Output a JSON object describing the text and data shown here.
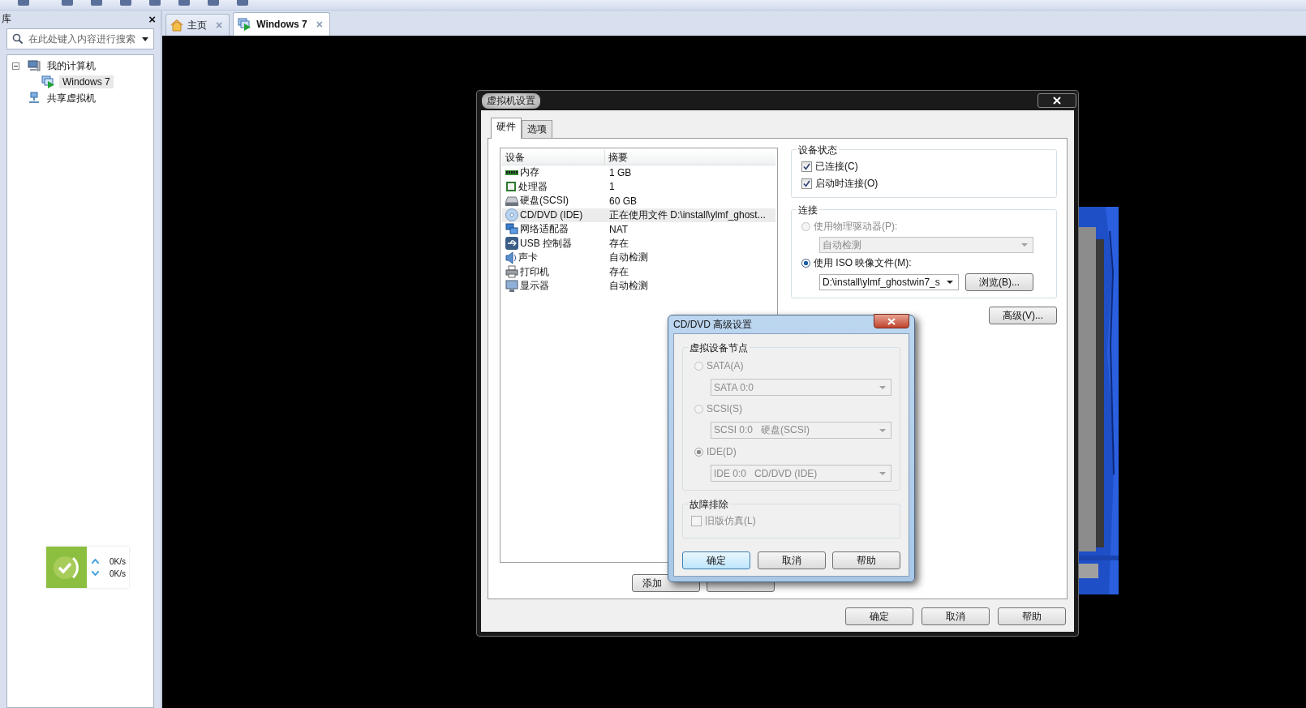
{
  "library": {
    "title": "库",
    "close": "×",
    "search": {
      "placeholder": "在此处键入内容进行搜索"
    },
    "tree": [
      {
        "label": "我的计算机",
        "kind": "computer",
        "expanded": true,
        "selected": false,
        "children": [
          {
            "label": "Windows 7",
            "kind": "vm",
            "selected": true
          }
        ]
      },
      {
        "label": "共享虚拟机",
        "kind": "shared",
        "selected": false
      }
    ]
  },
  "tabs": [
    {
      "label": "主页",
      "kind": "home",
      "selected": false,
      "close": "×"
    },
    {
      "label": "Windows 7",
      "kind": "vm",
      "selected": true,
      "close": "×"
    }
  ],
  "network_widget": {
    "upload": "0K/s",
    "download": "0K/s"
  },
  "settings_dialog": {
    "title": "虚拟机设置",
    "tabs": [
      {
        "label": "硬件",
        "selected": true
      },
      {
        "label": "选项",
        "selected": false
      }
    ],
    "device_table": {
      "columns": [
        "设备",
        "摘要"
      ],
      "rows": [
        {
          "kind": "memory",
          "device": "内存",
          "summary": "1 GB",
          "selected": false
        },
        {
          "kind": "cpu",
          "device": "处理器",
          "summary": "1",
          "selected": false
        },
        {
          "kind": "disk",
          "device": "硬盘(SCSI)",
          "summary": "60 GB",
          "selected": false
        },
        {
          "kind": "cdrom",
          "device": "CD/DVD (IDE)",
          "summary": "正在使用文件 D:\\install\\ylmf_ghost...",
          "selected": true
        },
        {
          "kind": "network",
          "device": "网络适配器",
          "summary": "NAT",
          "selected": false
        },
        {
          "kind": "usb",
          "device": "USB 控制器",
          "summary": "存在",
          "selected": false
        },
        {
          "kind": "sound",
          "device": "声卡",
          "summary": "自动检测",
          "selected": false
        },
        {
          "kind": "printer",
          "device": "打印机",
          "summary": "存在",
          "selected": false
        },
        {
          "kind": "display",
          "device": "显示器",
          "summary": "自动检测",
          "selected": false
        }
      ]
    },
    "list_buttons": [
      "添加"
    ],
    "device_status": {
      "title": "设备状态",
      "options": [
        {
          "label": "已连接(C)",
          "checked": true
        },
        {
          "label": "启动时连接(O)",
          "checked": true
        }
      ]
    },
    "connection": {
      "title": "连接",
      "physical": {
        "label": "使用物理驱动器(P):",
        "selected": false,
        "disabled": true,
        "value": "自动检测"
      },
      "iso": {
        "label": "使用 ISO 映像文件(M):",
        "selected": true,
        "disabled": false,
        "value": "D:\\install\\ylmf_ghostwin7_s",
        "browse": "浏览(B)..."
      }
    },
    "advanced": "高级(V)...",
    "buttons": [
      "确定",
      "取消",
      "帮助"
    ]
  },
  "advanced_dialog": {
    "title": "CD/DVD 高级设置",
    "node_group": {
      "title": "虚拟设备节点",
      "options": [
        {
          "label": "SATA(A)",
          "selected": false,
          "disabled": true,
          "value": "SATA 0:0"
        },
        {
          "label": "SCSI(S)",
          "selected": false,
          "disabled": true,
          "value": "SCSI 0:0   硬盘(SCSI)"
        },
        {
          "label": "IDE(D)",
          "selected": true,
          "disabled": true,
          "value": "IDE 0:0   CD/DVD (IDE)"
        }
      ]
    },
    "troubleshoot": {
      "title": "故障排除",
      "option": {
        "label": "旧版仿真(L)",
        "checked": false,
        "disabled": true
      }
    },
    "buttons": [
      {
        "label": "确定",
        "default": true
      },
      {
        "label": "取消",
        "default": false
      },
      {
        "label": "帮助",
        "default": false
      }
    ]
  }
}
